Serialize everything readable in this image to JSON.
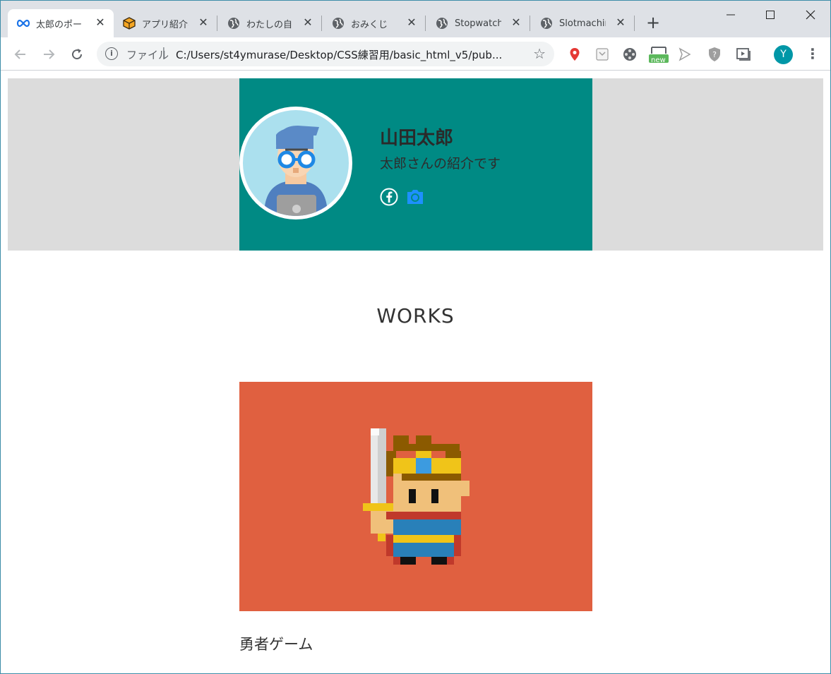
{
  "browser": {
    "tabs": [
      {
        "title": "太郎のポートフォリオ",
        "icon": "infinity-icon"
      },
      {
        "title": "アプリ紹介ページ",
        "icon": "box-icon"
      },
      {
        "title": "わたしの自己紹介",
        "icon": "globe-icon"
      },
      {
        "title": "おみくじ",
        "icon": "globe-icon"
      },
      {
        "title": "Stopwatch",
        "icon": "globe-icon"
      },
      {
        "title": "Slotmachine",
        "icon": "globe-icon"
      }
    ],
    "new_tab_label": "+",
    "scheme_label": "ファイル",
    "url": "C:/Users/st4ymurase/Desktop/CSS練習用/basic_html_v5/pub...",
    "extensions_new_badge": "new",
    "profile_initial": "Y"
  },
  "profile": {
    "name": "山田太郎",
    "intro": "太郎さんの紹介です"
  },
  "works": {
    "heading": "WORKS",
    "items": [
      {
        "label": "勇者ゲーム"
      }
    ]
  },
  "colors": {
    "hero_bg": "#dcdcdc",
    "profile_bg": "#008a84",
    "work_card_bg": "#e06040",
    "accent_blue": "#1a73e8"
  }
}
